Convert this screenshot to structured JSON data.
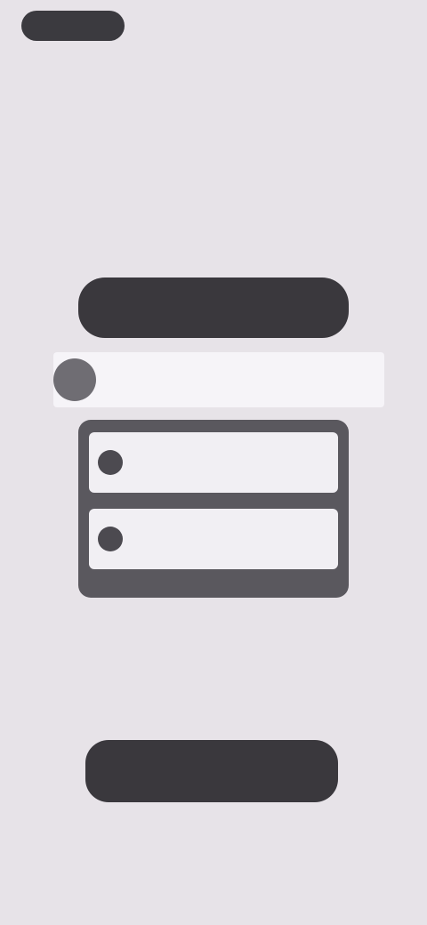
{
  "status_bar": {
    "right_text": ""
  },
  "header": {
    "headline": "",
    "subline": ""
  },
  "main": {
    "top_button_label": "",
    "selected_row_text": "",
    "options": [
      {
        "label": ""
      },
      {
        "label": ""
      }
    ]
  },
  "footer": {
    "continue_label": "",
    "link_text": ""
  }
}
